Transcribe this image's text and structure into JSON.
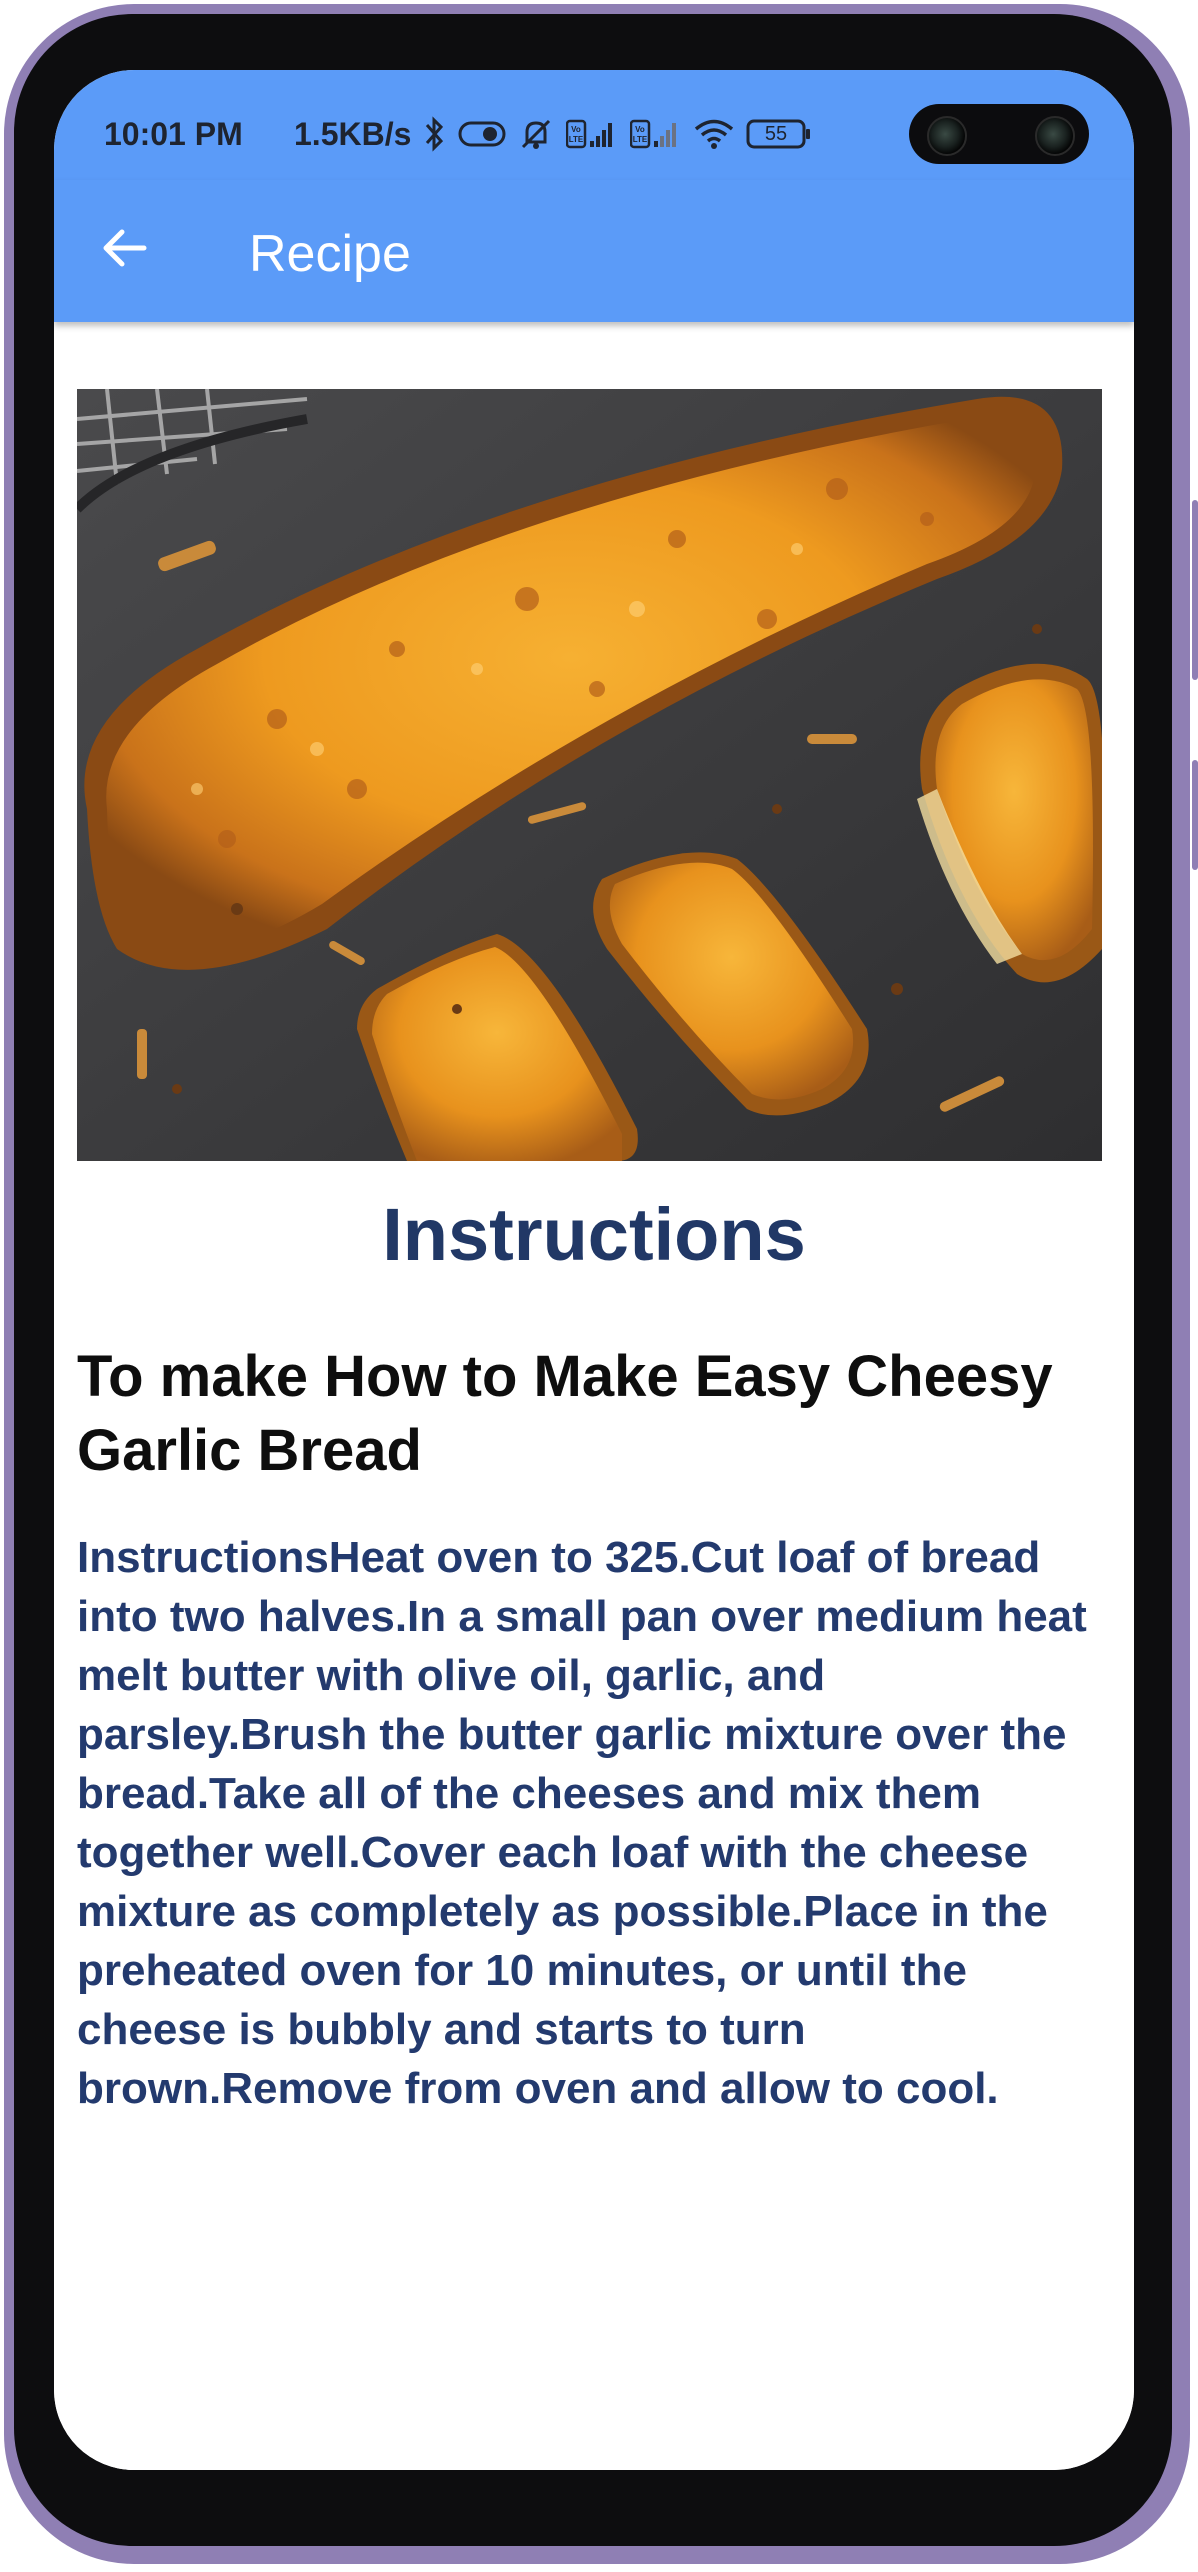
{
  "status_bar": {
    "time": "10:01 PM",
    "network_speed": "1.5KB/s",
    "battery_level": "55",
    "icons": [
      "bluetooth-icon",
      "toggle-icon",
      "mute-icon",
      "volte-signal-icon",
      "volte-signal-icon",
      "wifi-icon",
      "battery-icon"
    ]
  },
  "app_bar": {
    "title": "Recipe",
    "back_icon": "arrow-left-icon"
  },
  "main": {
    "image_subject": "cheesy-garlic-bread-photo",
    "section_heading": "Instructions",
    "recipe_title": "To make How to Make Easy Cheesy Garlic Bread",
    "instructions_text": "InstructionsHeat oven to 325.Cut loaf of bread into two halves.In a small pan over medium heat melt butter with olive oil, garlic, and parsley.Brush the butter garlic mixture over the bread.Take all of the cheeses and mix them together well.Cover each loaf with the cheese mixture as completely as possible.Place in the preheated oven for 10 minutes, or until the cheese is bubbly and starts to turn brown.Remove from oven and allow to cool."
  },
  "colors": {
    "app_bar": "#5b9bf8",
    "heading": "#213866",
    "body_text": "#233a6e",
    "frame": "#8f7fb4"
  }
}
